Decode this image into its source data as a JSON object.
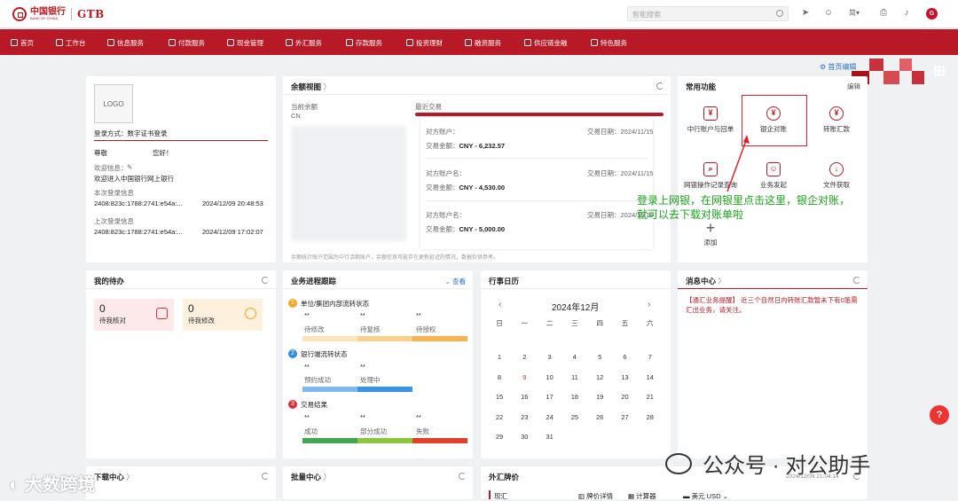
{
  "header": {
    "bank_cn": "中国银行",
    "bank_en": "BANK OF CHINA",
    "brand": "GTB",
    "search_placeholder": "智能搜索",
    "lang": "简",
    "avatar": "G"
  },
  "nav": {
    "items": [
      "首页",
      "工作台",
      "信息服务",
      "付款服务",
      "现金管理",
      "外汇服务",
      "存款服务",
      "投资理财",
      "融资服务",
      "供应链金融",
      "特色服务"
    ]
  },
  "home_edit": "首页编辑",
  "user_card": {
    "logo": "LOGO",
    "login_method": "登录方式：数字证书登录",
    "greeting_prefix": "尊敬",
    "greeting_suffix": "您好！",
    "welcome_label": "欢迎信息：",
    "welcome_text": "欢迎进入中国银行网上银行",
    "this_login_label": "本次登录信息",
    "this_login_ip": "2408:823c:1788:2741:e54a:...",
    "this_login_time": "2024/12/09 20:48:53",
    "last_login_label": "上次登录信息",
    "last_login_ip": "2408:823c:1788:2741:e54a:...",
    "last_login_time": "2024/12/09 17:02:07"
  },
  "balance": {
    "title": "余额视图",
    "current_balance": "当前余额",
    "ccy": "CN",
    "recent_tx": "最近交易",
    "footer": "余额统计账户范围为中行活期账户，余额信息可能存在更新延迟的情况，数据仅供参考。",
    "transactions": [
      {
        "acct_label": "对方账户：",
        "date_label": "交易日期：",
        "date": "2024/11/15",
        "amt_label": "交易金额：",
        "amount": "CNY - 6,232.57"
      },
      {
        "acct_label": "对方账户名：",
        "date_label": "交易日期：",
        "date": "2024/11/15",
        "amt_label": "交易金额：",
        "amount": "CNY - 4,530.00"
      },
      {
        "acct_label": "对方账户名：",
        "date_label": "交易日期：",
        "date": "2024/11/15",
        "amt_label": "交易金额：",
        "amount": "CNY - 5,000.00"
      }
    ]
  },
  "common": {
    "title": "常用功能",
    "edit": "编辑",
    "items": [
      "中行账户与回单",
      "银企对账",
      "转账汇款",
      "网银操作记录查询",
      "业务发起",
      "文件获取",
      "添加"
    ]
  },
  "annotation": "登录上网银，在网银里点击这里，银企对账，就可以去下载对账单啦",
  "todo": {
    "title": "我的待办",
    "items": [
      {
        "count": "0",
        "label": "待我核对"
      },
      {
        "count": "0",
        "label": "待我修改"
      }
    ]
  },
  "progress": {
    "title": "业务进程跟踪",
    "view": "查看",
    "groups": [
      {
        "num": "1",
        "name": "单位/集团内部流转状态",
        "stats": [
          "**",
          "**",
          "**"
        ],
        "labels": [
          "待修改",
          "待复核",
          "待授权"
        ]
      },
      {
        "num": "2",
        "name": "银行端流转状态",
        "stats": [
          "**",
          "**"
        ],
        "labels": [
          "预约成功",
          "处理中"
        ]
      },
      {
        "num": "3",
        "name": "交易结果",
        "stats": [
          "**",
          "**",
          "**"
        ],
        "labels": [
          "成功",
          "部分成功",
          "失败"
        ]
      }
    ]
  },
  "calendar": {
    "title": "行事日历",
    "month": "2024年12月",
    "weekdays": [
      "日",
      "一",
      "二",
      "三",
      "四",
      "五",
      "六"
    ],
    "weeks": [
      [
        "1",
        "2",
        "3",
        "4",
        "5",
        "6",
        "7"
      ],
      [
        "8",
        "9",
        "10",
        "11",
        "12",
        "13",
        "14"
      ],
      [
        "15",
        "16",
        "17",
        "18",
        "19",
        "20",
        "21"
      ],
      [
        "22",
        "23",
        "24",
        "25",
        "26",
        "27",
        "28"
      ],
      [
        "29",
        "30",
        "31",
        "",
        "",
        "",
        ""
      ]
    ],
    "today": "9"
  },
  "messages": {
    "title": "消息中心",
    "text": "【通汇业务提醒】 近三个自然日内转账汇款暂未下有0笔需汇出业务，请关注。"
  },
  "bottom": {
    "download": "下载中心",
    "batch": "批量中心",
    "fx": "外汇牌价",
    "fx_time": "2024/12/09 21:04:14",
    "fx_cash": "现汇",
    "fx_detail": "牌价详情",
    "fx_calc": "计算器",
    "fx_ccy": "美元 USD"
  },
  "watermark": {
    "left": "大数跨境",
    "right": "公众号 · 对公助手"
  }
}
